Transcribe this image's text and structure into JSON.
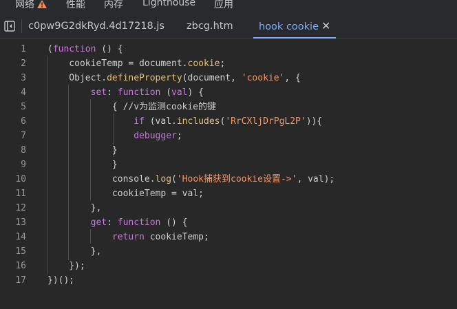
{
  "topbar": {
    "tabs": [
      "网络",
      "性能",
      "内存",
      "Lighthouse",
      "应用"
    ]
  },
  "filebar": {
    "tabs": [
      "c0pw9G2dkRyd.4d17218.js",
      "zbcg.htm",
      "hook cookie"
    ],
    "active_index": 2,
    "close_glyph": "✕"
  },
  "code": {
    "lines": [
      {
        "n": "1",
        "t": "(function () {"
      },
      {
        "n": "2",
        "t": "    cookieTemp = document.cookie;"
      },
      {
        "n": "3",
        "t": "    Object.defineProperty(document, 'cookie', {"
      },
      {
        "n": "4",
        "t": "        set: function (val) {"
      },
      {
        "n": "5",
        "t": "            { //v为监测cookie的键"
      },
      {
        "n": "6",
        "t": "                if (val.includes('RrCXljDrPgL2P')){"
      },
      {
        "n": "7",
        "t": "                debugger;"
      },
      {
        "n": "8",
        "t": "            }"
      },
      {
        "n": "9",
        "t": "            }"
      },
      {
        "n": "10",
        "t": "            console.log('Hook捕获到cookie设置->', val);"
      },
      {
        "n": "11",
        "t": "            cookieTemp = val;"
      },
      {
        "n": "12",
        "t": "        },"
      },
      {
        "n": "13",
        "t": "        get: function () {"
      },
      {
        "n": "14",
        "t": "            return cookieTemp;"
      },
      {
        "n": "15",
        "t": "        },"
      },
      {
        "n": "16",
        "t": "    });"
      },
      {
        "n": "17",
        "t": "})();"
      }
    ]
  },
  "icons": {
    "warning": "warning-triangle-icon",
    "sidebar_toggle": "sidebar-toggle-icon"
  },
  "colors": {
    "active_tab": "#7cacf8",
    "keyword": "#c678dd",
    "string": "#f29766",
    "property": "#e5c07b",
    "warning": "#f28b54"
  }
}
